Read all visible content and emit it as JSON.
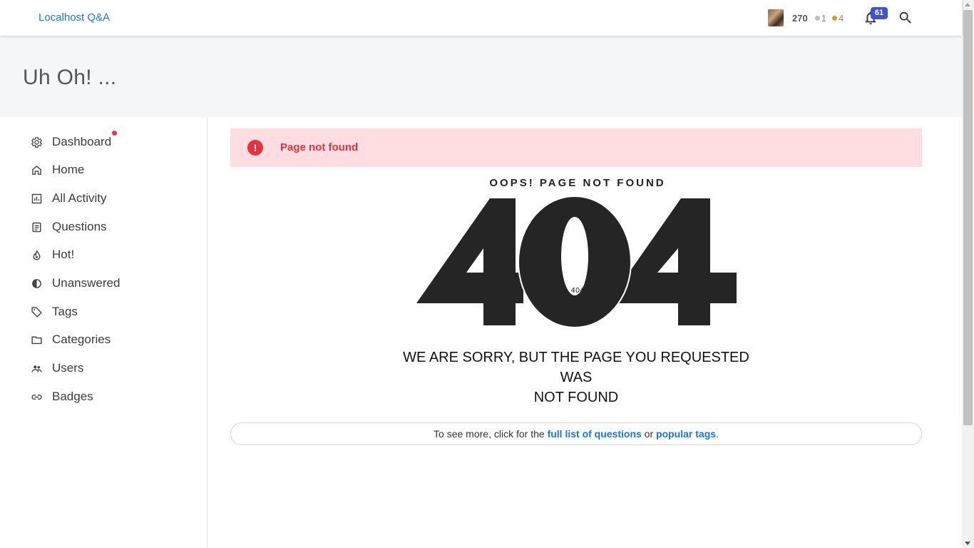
{
  "topbar": {
    "brand": "Localhost Q&A",
    "user_points": "270",
    "silver_badges": "1",
    "gold_badges": "4",
    "notification_count": "61"
  },
  "header": {
    "title": "Uh Oh! ..."
  },
  "sidebar": {
    "items": [
      {
        "label": "Dashboard",
        "icon": "gear-icon"
      },
      {
        "label": "Home",
        "icon": "home-icon"
      },
      {
        "label": "All Activity",
        "icon": "chart-icon"
      },
      {
        "label": "Questions",
        "icon": "document-icon"
      },
      {
        "label": "Hot!",
        "icon": "flame-icon"
      },
      {
        "label": "Unanswered",
        "icon": "half-circle-icon"
      },
      {
        "label": "Tags",
        "icon": "tag-icon"
      },
      {
        "label": "Categories",
        "icon": "folder-icon"
      },
      {
        "label": "Users",
        "icon": "users-icon"
      },
      {
        "label": "Badges",
        "icon": "link-icon"
      }
    ]
  },
  "main": {
    "alert_text": "Page not found",
    "alert_icon": "!",
    "oops": "OOPS! PAGE NOT FOUND",
    "code": "404",
    "sorry_line1": "WE ARE SORRY, BUT THE PAGE YOU REQUESTED WAS",
    "sorry_line2": "NOT FOUND",
    "more_prefix": "To see more, click for the ",
    "more_link1": "full list of questions",
    "more_mid": " or ",
    "more_link2": "popular tags",
    "more_suffix": "."
  },
  "colors": {
    "accent": "#1a73e8",
    "alert_bg": "#ffdde0",
    "alert_fg": "#e6323e",
    "notification_badge": "#3f51d4",
    "silver": "#c0c0c0",
    "gold": "#d4a017"
  }
}
